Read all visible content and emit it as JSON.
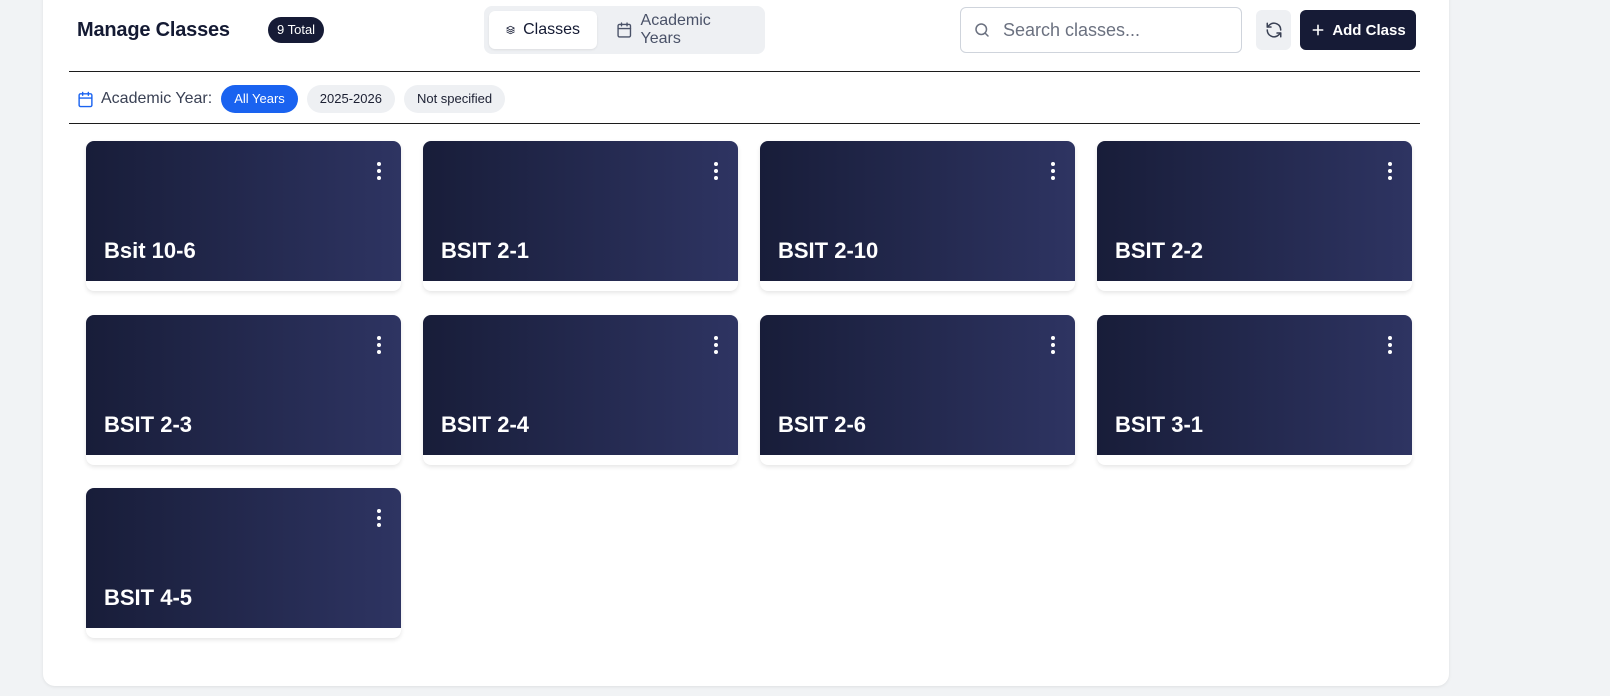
{
  "header": {
    "title": "Manage Classes",
    "total_badge": "9 Total",
    "tabs": [
      {
        "label": "Classes",
        "icon": "layers-icon",
        "active": true
      },
      {
        "label": "Academic Years",
        "icon": "calendar-icon",
        "active": false
      }
    ],
    "search": {
      "placeholder": "Search classes...",
      "value": ""
    },
    "add_label": "Add Class"
  },
  "filter": {
    "label": "Academic Year:",
    "chips": [
      {
        "label": "All Years",
        "active": true
      },
      {
        "label": "2025-2026",
        "active": false
      },
      {
        "label": "Not specified",
        "active": false
      }
    ]
  },
  "classes": [
    {
      "name": "Bsit 10-6"
    },
    {
      "name": "BSIT 2-1"
    },
    {
      "name": "BSIT 2-10"
    },
    {
      "name": "BSIT 2-2"
    },
    {
      "name": "BSIT 2-3"
    },
    {
      "name": "BSIT 2-4"
    },
    {
      "name": "BSIT 2-6"
    },
    {
      "name": "BSIT 3-1"
    },
    {
      "name": "BSIT 4-5"
    }
  ],
  "colors": {
    "accent": "#1a63f0",
    "dark": "#161b36",
    "card_gradient_start": "#181d39",
    "card_gradient_end": "#2e3462"
  }
}
